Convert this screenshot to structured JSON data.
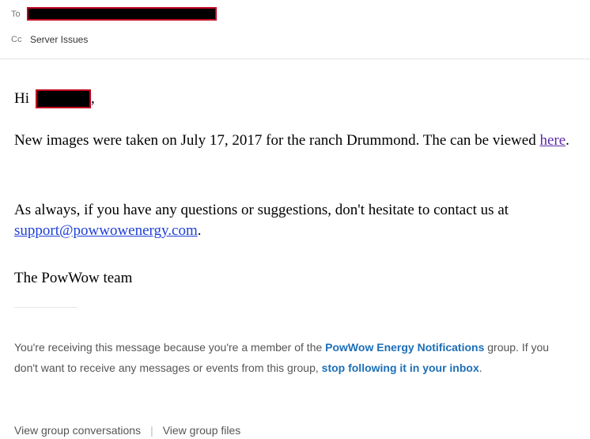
{
  "header": {
    "to_label": "To",
    "cc_label": "Cc",
    "cc_value": "Server Issues"
  },
  "message": {
    "greeting": "Hi",
    "greeting_end": ",",
    "para1_text": "New images were taken on July 17, 2017 for the ranch Drummond. The can be viewed ",
    "para1_link": "here",
    "para1_end": ".",
    "para2_text": "As always, if you have any questions or suggestions, don't hesitate to contact us at ",
    "para2_link": "support@powwowenergy.com",
    "para2_end": ".",
    "signature": "The PowWow team"
  },
  "footer": {
    "text1": "You're receiving this message because you're a member of the ",
    "group_link": "PowWow Energy Notifications",
    "text2": " group. If you don't want to receive any messages or events from this group, ",
    "unfollow_link": "stop following it in your inbox",
    "text3": "."
  },
  "actions": {
    "view_conversations": "View group conversations",
    "separator": "|",
    "view_files": "View group files"
  }
}
